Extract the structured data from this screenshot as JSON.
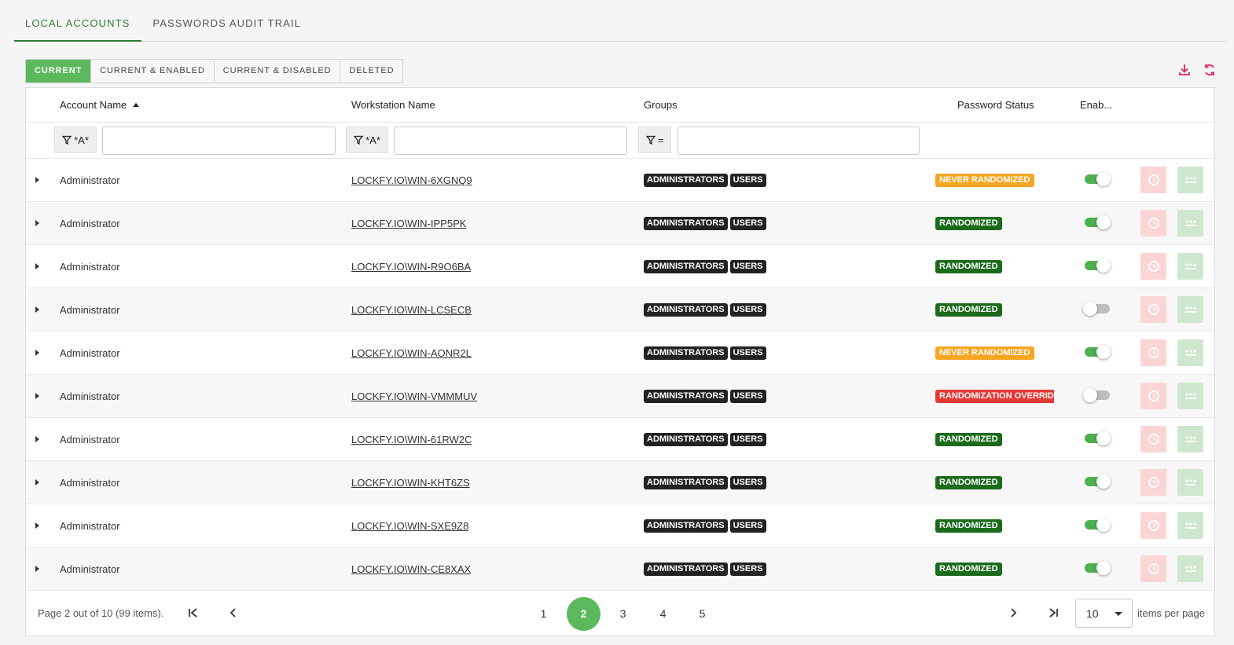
{
  "tabs": [
    {
      "label": "LOCAL ACCOUNTS",
      "active": true
    },
    {
      "label": "PASSWORDS AUDIT TRAIL",
      "active": false
    }
  ],
  "filters": [
    "CURRENT",
    "CURRENT & ENABLED",
    "CURRENT & DISABLED",
    "DELETED"
  ],
  "active_filter": "CURRENT",
  "toolbar": {
    "download_icon": "download-icon",
    "refresh_icon": "refresh-icon"
  },
  "columns": {
    "account": "Account Name",
    "workstation": "Workstation Name",
    "groups": "Groups",
    "password_status": "Password Status",
    "enabled": "Enab..."
  },
  "column_filters": {
    "account_op": "*A*",
    "workstation_op": "*A*",
    "groups_op": "=",
    "account_value": "",
    "workstation_value": "",
    "groups_value": ""
  },
  "rows": [
    {
      "account": "Administrator",
      "workstation": "LOCKFY.IO\\WIN-6XGNQ9",
      "groups": [
        "ADMINISTRATORS",
        "USERS"
      ],
      "status": "NEVER RANDOMIZED",
      "status_kind": "orange",
      "enabled": true
    },
    {
      "account": "Administrator",
      "workstation": "LOCKFY.IO\\WIN-IPP5PK",
      "groups": [
        "ADMINISTRATORS",
        "USERS"
      ],
      "status": "RANDOMIZED",
      "status_kind": "green",
      "enabled": true
    },
    {
      "account": "Administrator",
      "workstation": "LOCKFY.IO\\WIN-R9O6BA",
      "groups": [
        "ADMINISTRATORS",
        "USERS"
      ],
      "status": "RANDOMIZED",
      "status_kind": "green",
      "enabled": true
    },
    {
      "account": "Administrator",
      "workstation": "LOCKFY.IO\\WIN-LCSECB",
      "groups": [
        "ADMINISTRATORS",
        "USERS"
      ],
      "status": "RANDOMIZED",
      "status_kind": "green",
      "enabled": false
    },
    {
      "account": "Administrator",
      "workstation": "LOCKFY.IO\\WIN-AONR2L",
      "groups": [
        "ADMINISTRATORS",
        "USERS"
      ],
      "status": "NEVER RANDOMIZED",
      "status_kind": "orange",
      "enabled": true
    },
    {
      "account": "Administrator",
      "workstation": "LOCKFY.IO\\WIN-VMMMUV",
      "groups": [
        "ADMINISTRATORS",
        "USERS"
      ],
      "status": "RANDOMIZATION OVERRIDDEN",
      "status_kind": "red",
      "enabled": false
    },
    {
      "account": "Administrator",
      "workstation": "LOCKFY.IO\\WIN-61RW2C",
      "groups": [
        "ADMINISTRATORS",
        "USERS"
      ],
      "status": "RANDOMIZED",
      "status_kind": "green",
      "enabled": true
    },
    {
      "account": "Administrator",
      "workstation": "LOCKFY.IO\\WIN-KHT6ZS",
      "groups": [
        "ADMINISTRATORS",
        "USERS"
      ],
      "status": "RANDOMIZED",
      "status_kind": "green",
      "enabled": true
    },
    {
      "account": "Administrator",
      "workstation": "LOCKFY.IO\\WIN-SXE9Z8",
      "groups": [
        "ADMINISTRATORS",
        "USERS"
      ],
      "status": "RANDOMIZED",
      "status_kind": "green",
      "enabled": true
    },
    {
      "account": "Administrator",
      "workstation": "LOCKFY.IO\\WIN-CE8XAX",
      "groups": [
        "ADMINISTRATORS",
        "USERS"
      ],
      "status": "RANDOMIZED",
      "status_kind": "green",
      "enabled": true
    }
  ],
  "pager": {
    "info": "Page 2 out of 10 (99 items).",
    "pages": [
      "1",
      "2",
      "3",
      "4",
      "5"
    ],
    "current_page": "2",
    "page_size": "10",
    "items_per_page_label": "items per page"
  },
  "colors": {
    "accent": "#5cb85c",
    "tab_active": "#2e7d32",
    "status_green": "#1b6b1b",
    "status_orange": "#f5a623",
    "status_red": "#e53935",
    "icon_pink": "#e91e63"
  }
}
